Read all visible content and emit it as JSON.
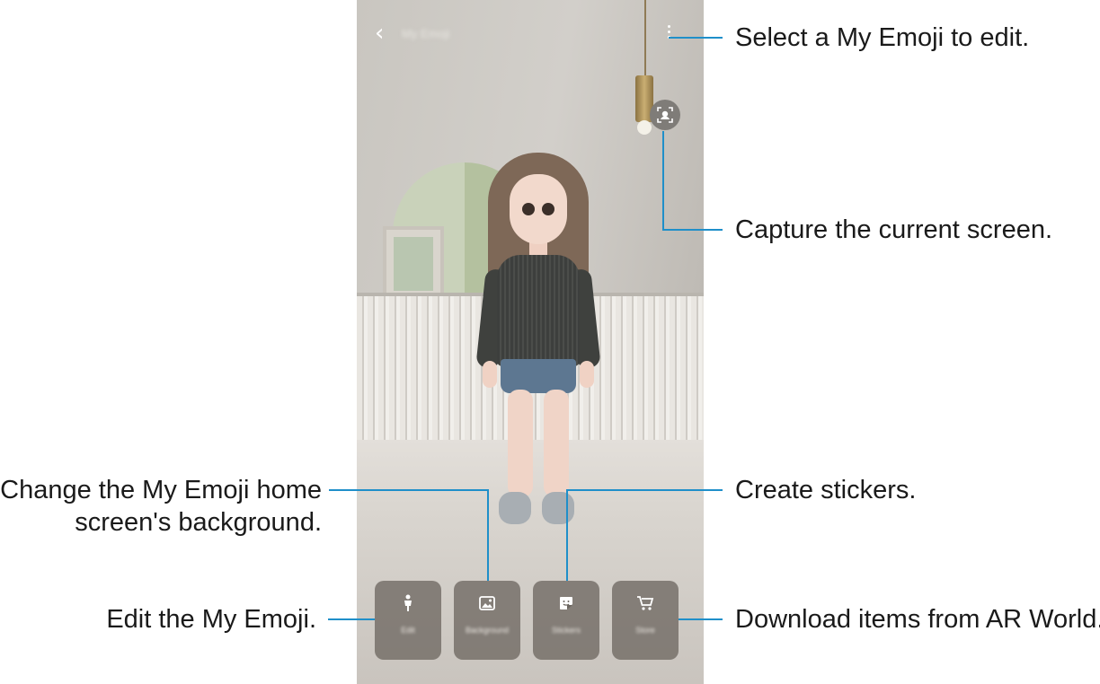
{
  "app": {
    "title": "My Emoji",
    "back_icon": "chevron-left-icon",
    "menu_icon": "more-vertical-icon",
    "capture_icon": "capture-face-icon"
  },
  "toolbar": {
    "buttons": [
      {
        "label": "Edit",
        "icon": "person-icon"
      },
      {
        "label": "Background",
        "icon": "image-icon"
      },
      {
        "label": "Stickers",
        "icon": "sticker-icon"
      },
      {
        "label": "Store",
        "icon": "cart-icon"
      }
    ]
  },
  "callouts": {
    "menu": "Select a My Emoji to edit.",
    "capture": "Capture the current screen.",
    "background_line1": "Change the My Emoji home",
    "background_line2": "screen's background.",
    "stickers": "Create stickers.",
    "edit": "Edit the My Emoji.",
    "store": "Download items from AR World."
  },
  "colors": {
    "callout_line": "#1f8fc9"
  }
}
